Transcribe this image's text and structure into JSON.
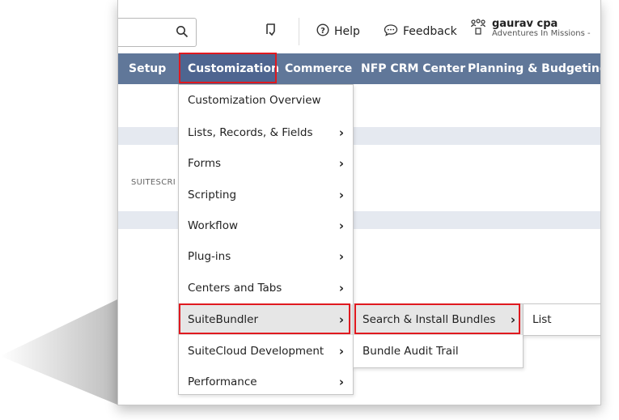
{
  "search": {
    "placeholder": ""
  },
  "header": {
    "help_label": "Help",
    "feedback_label": "Feedback",
    "user_name": "gaurav cpa",
    "user_company": "Adventures In Missions -"
  },
  "nav": {
    "items": [
      "Setup",
      "Customization",
      "Commerce",
      "NFP CRM Center",
      "Planning & Budgeting"
    ],
    "active": "Customization"
  },
  "background": {
    "section_label": "SUITESCRI"
  },
  "customization_menu": {
    "items": [
      {
        "label": "Customization Overview",
        "has_submenu": false
      },
      {
        "label": "Lists, Records, & Fields",
        "has_submenu": true
      },
      {
        "label": "Forms",
        "has_submenu": true
      },
      {
        "label": "Scripting",
        "has_submenu": true
      },
      {
        "label": "Workflow",
        "has_submenu": true
      },
      {
        "label": "Plug-ins",
        "has_submenu": true
      },
      {
        "label": "Centers and Tabs",
        "has_submenu": true
      },
      {
        "label": "SuiteBundler",
        "has_submenu": true,
        "selected": true
      },
      {
        "label": "SuiteCloud Development",
        "has_submenu": true
      },
      {
        "label": "Performance",
        "has_submenu": true
      }
    ]
  },
  "suitebundler_menu": {
    "items": [
      {
        "label": "Search & Install Bundles",
        "has_submenu": true,
        "selected": true
      },
      {
        "label": "Bundle Audit Trail",
        "has_submenu": false
      }
    ]
  },
  "install_menu": {
    "items": [
      {
        "label": "List",
        "has_submenu": false
      }
    ]
  },
  "colors": {
    "nav_background": "#607799",
    "nav_active": "#4e6590",
    "highlight": "#e0191f",
    "band": "#e5e9f0"
  },
  "icons": [
    "search-icon",
    "recent-records-icon",
    "help-icon",
    "feedback-icon",
    "role-switch-icon",
    "chevron-right-icon"
  ]
}
